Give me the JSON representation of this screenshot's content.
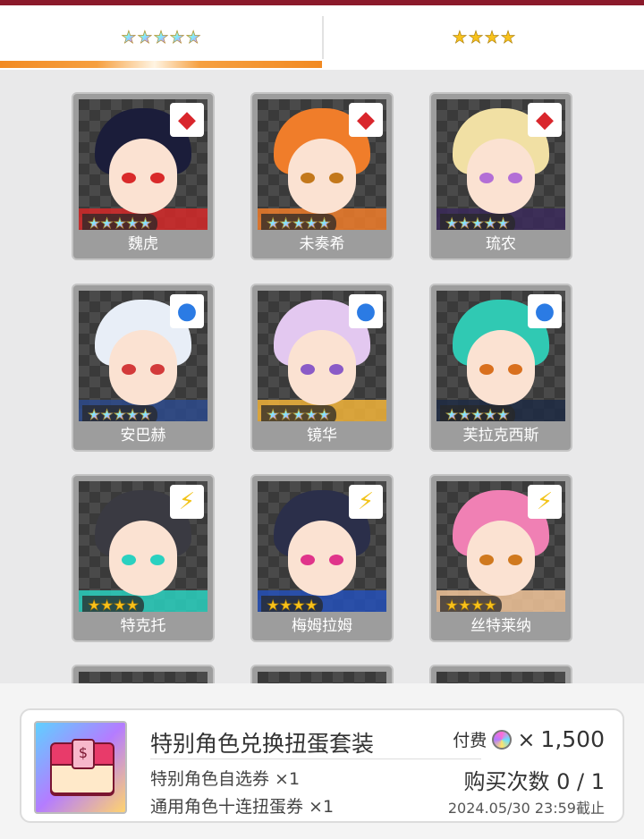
{
  "tabs": [
    {
      "stars": 5,
      "style": "rainbow",
      "selected": true
    },
    {
      "stars": 4,
      "style": "gold",
      "selected": false
    }
  ],
  "star_glyph": "★",
  "characters": [
    {
      "name": "魏虎",
      "stars": 5,
      "attribute": "red-diamond-icon",
      "hair": "#1b1d3a",
      "accent": "#d52929",
      "eye": "#d92a2a"
    },
    {
      "name": "未奏希",
      "stars": 5,
      "attribute": "red-diamond-icon",
      "hair": "#f07d2a",
      "accent": "#f07d2a",
      "eye": "#c3781b"
    },
    {
      "name": "琉农",
      "stars": 5,
      "attribute": "red-diamond-icon",
      "hair": "#f1e0a4",
      "accent": "#3b2a5a",
      "eye": "#b36fd6"
    },
    {
      "name": "安巴赫",
      "stars": 5,
      "attribute": "blue-circle-icon",
      "hair": "#e8eef7",
      "accent": "#2d4a8c",
      "eye": "#d33a3a"
    },
    {
      "name": "镜华",
      "stars": 5,
      "attribute": "blue-circle-icon",
      "hair": "#e3c8f0",
      "accent": "#f2b43a",
      "eye": "#8a5bc7"
    },
    {
      "name": "芙拉克西斯",
      "stars": 5,
      "attribute": "blue-circle-icon",
      "hair": "#30c9b3",
      "accent": "#1e2b44",
      "eye": "#d9701e"
    },
    {
      "name": "特克托",
      "stars": 4,
      "attribute": "yellow-lightning-icon",
      "hair": "#3a3a42",
      "accent": "#2ad1c0",
      "eye": "#2ad1c0"
    },
    {
      "name": "梅姆拉姆",
      "stars": 4,
      "attribute": "yellow-lightning-icon",
      "hair": "#2b2f4a",
      "accent": "#2550b8",
      "eye": "#e0348a"
    },
    {
      "name": "丝特莱纳",
      "stars": 4,
      "attribute": "yellow-lightning-icon",
      "hair": "#f080b4",
      "accent": "#f2c59a",
      "eye": "#d0791e"
    }
  ],
  "package": {
    "title": "特别角色兑换扭蛋套装",
    "item1": "特别角色自选券 ×1",
    "item2": "通用角色十连扭蛋券 ×1",
    "fee_label": "付费",
    "times": "×",
    "price": "1,500",
    "purchase_count": "购买次数 0 / 1",
    "deadline": "2024.05/30 23:59截止"
  }
}
